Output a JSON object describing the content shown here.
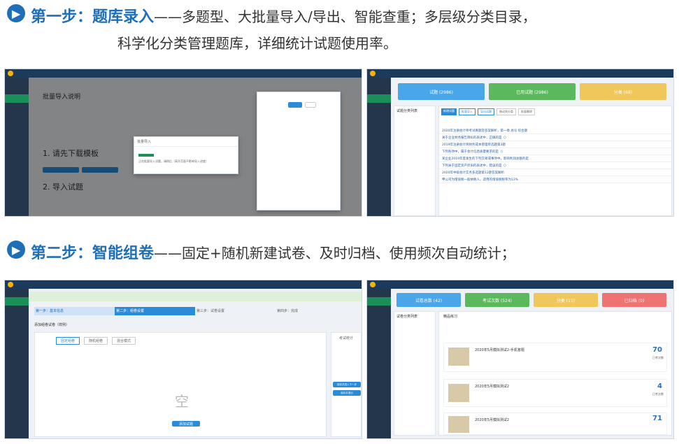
{
  "step1": {
    "icon": "play-circle-icon",
    "title": "第一步：题库录入",
    "desc_line1": "——多题型、大批量导入/导出、智能查重；多层级分类目录，",
    "desc_line2": "科学化分类管理题库，详细统计试题使用率。"
  },
  "step2": {
    "icon": "play-circle-icon",
    "title": "第二步：智能组卷",
    "desc_line1": "——固定+随机新建试卷、及时归档、使用频次自动统计；"
  },
  "shot1": {
    "heading": "批量导入说明",
    "sub1": "1. 请先下载模板",
    "sub2": "2. 导入试题",
    "modal_title": "批量导入",
    "modal_text": "正在批量导入试题，请稍后（离开页面不影响导入进度）"
  },
  "shot2": {
    "cards": [
      "试题 (2986)",
      "已用试题 (2986)",
      "分类 (68)"
    ],
    "tree_title": "试题分类列表",
    "buttons": [
      "新增试题",
      "批量导入",
      "导出试题",
      "移动到分类",
      "批量删除"
    ],
    "rows": [
      "2020年注册会计师考试真题及答案解析，第一章 总论 综合题",
      "关于企业财务报告目标的表述中，正确的是（）",
      "2019年注册会计师财务成本管理单选题第3题",
      "下列各项中，属于会计信息质量要求的是（）",
      "某企业2019年度发生的下列交易或事项中，影响利润总额的是",
      "下列关于固定资产折旧的表述中，错误的是（）",
      "2020年中级会计实务多选题第12题答案解析",
      "甲公司为增值税一般纳税人，适用的增值税税率为13%"
    ]
  },
  "shot3": {
    "steps": [
      "第一步：基本信息",
      "第二步：组卷设置",
      "第三步：试卷设置",
      "第四步：完成"
    ],
    "form_title": "添加组卷试卷（样例）",
    "tabs": [
      "固定组卷",
      "随机组卷",
      "混合模式"
    ],
    "empty": "空",
    "add_btn": "添加试题",
    "stats_title": "考试统计",
    "save_btn": "保存并进入下一步",
    "exit_btn": "保存并退出"
  },
  "shot4": {
    "cards": [
      "试卷总数 (42)",
      "考试次数 (524)",
      "分类 (11)",
      "已归档 (0)"
    ],
    "tree_title": "试卷分类列表",
    "list_title": "精品练习",
    "papers": [
      {
        "title": "2020年5月模拟测试2-手机答题",
        "count": "70"
      },
      {
        "title": "2020年5月模拟测试2",
        "count": "4"
      },
      {
        "title": "2020年5月模拟测试2",
        "count": "71"
      }
    ],
    "count_label": "已考次数"
  }
}
